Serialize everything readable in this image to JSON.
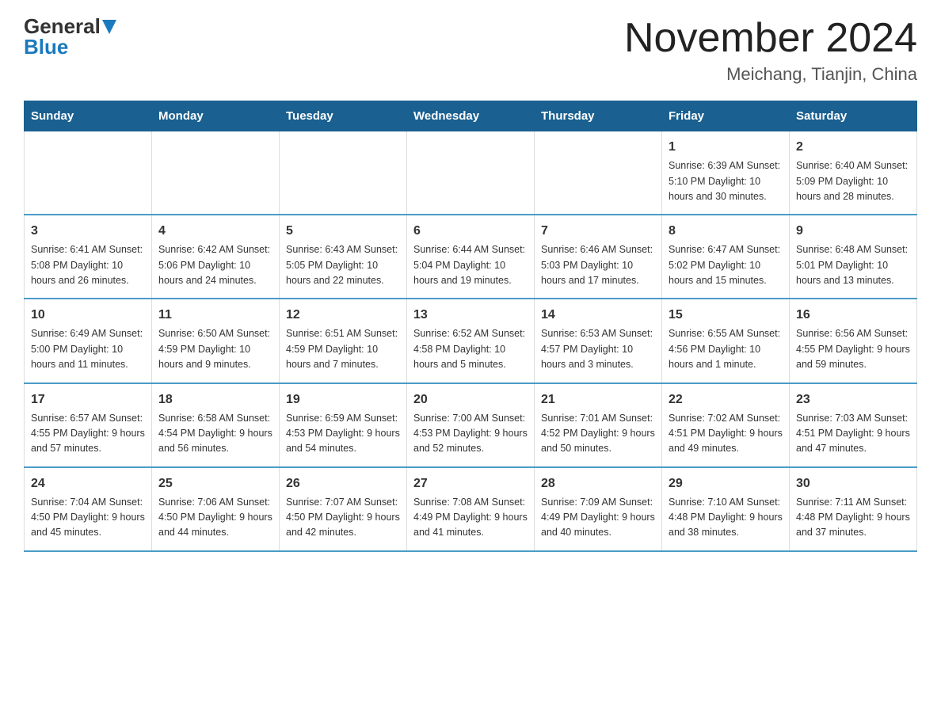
{
  "header": {
    "logo_general": "General",
    "logo_blue": "Blue",
    "month_title": "November 2024",
    "location": "Meichang, Tianjin, China"
  },
  "weekdays": [
    "Sunday",
    "Monday",
    "Tuesday",
    "Wednesday",
    "Thursday",
    "Friday",
    "Saturday"
  ],
  "weeks": [
    [
      {
        "day": "",
        "info": ""
      },
      {
        "day": "",
        "info": ""
      },
      {
        "day": "",
        "info": ""
      },
      {
        "day": "",
        "info": ""
      },
      {
        "day": "",
        "info": ""
      },
      {
        "day": "1",
        "info": "Sunrise: 6:39 AM\nSunset: 5:10 PM\nDaylight: 10 hours\nand 30 minutes."
      },
      {
        "day": "2",
        "info": "Sunrise: 6:40 AM\nSunset: 5:09 PM\nDaylight: 10 hours\nand 28 minutes."
      }
    ],
    [
      {
        "day": "3",
        "info": "Sunrise: 6:41 AM\nSunset: 5:08 PM\nDaylight: 10 hours\nand 26 minutes."
      },
      {
        "day": "4",
        "info": "Sunrise: 6:42 AM\nSunset: 5:06 PM\nDaylight: 10 hours\nand 24 minutes."
      },
      {
        "day": "5",
        "info": "Sunrise: 6:43 AM\nSunset: 5:05 PM\nDaylight: 10 hours\nand 22 minutes."
      },
      {
        "day": "6",
        "info": "Sunrise: 6:44 AM\nSunset: 5:04 PM\nDaylight: 10 hours\nand 19 minutes."
      },
      {
        "day": "7",
        "info": "Sunrise: 6:46 AM\nSunset: 5:03 PM\nDaylight: 10 hours\nand 17 minutes."
      },
      {
        "day": "8",
        "info": "Sunrise: 6:47 AM\nSunset: 5:02 PM\nDaylight: 10 hours\nand 15 minutes."
      },
      {
        "day": "9",
        "info": "Sunrise: 6:48 AM\nSunset: 5:01 PM\nDaylight: 10 hours\nand 13 minutes."
      }
    ],
    [
      {
        "day": "10",
        "info": "Sunrise: 6:49 AM\nSunset: 5:00 PM\nDaylight: 10 hours\nand 11 minutes."
      },
      {
        "day": "11",
        "info": "Sunrise: 6:50 AM\nSunset: 4:59 PM\nDaylight: 10 hours\nand 9 minutes."
      },
      {
        "day": "12",
        "info": "Sunrise: 6:51 AM\nSunset: 4:59 PM\nDaylight: 10 hours\nand 7 minutes."
      },
      {
        "day": "13",
        "info": "Sunrise: 6:52 AM\nSunset: 4:58 PM\nDaylight: 10 hours\nand 5 minutes."
      },
      {
        "day": "14",
        "info": "Sunrise: 6:53 AM\nSunset: 4:57 PM\nDaylight: 10 hours\nand 3 minutes."
      },
      {
        "day": "15",
        "info": "Sunrise: 6:55 AM\nSunset: 4:56 PM\nDaylight: 10 hours\nand 1 minute."
      },
      {
        "day": "16",
        "info": "Sunrise: 6:56 AM\nSunset: 4:55 PM\nDaylight: 9 hours\nand 59 minutes."
      }
    ],
    [
      {
        "day": "17",
        "info": "Sunrise: 6:57 AM\nSunset: 4:55 PM\nDaylight: 9 hours\nand 57 minutes."
      },
      {
        "day": "18",
        "info": "Sunrise: 6:58 AM\nSunset: 4:54 PM\nDaylight: 9 hours\nand 56 minutes."
      },
      {
        "day": "19",
        "info": "Sunrise: 6:59 AM\nSunset: 4:53 PM\nDaylight: 9 hours\nand 54 minutes."
      },
      {
        "day": "20",
        "info": "Sunrise: 7:00 AM\nSunset: 4:53 PM\nDaylight: 9 hours\nand 52 minutes."
      },
      {
        "day": "21",
        "info": "Sunrise: 7:01 AM\nSunset: 4:52 PM\nDaylight: 9 hours\nand 50 minutes."
      },
      {
        "day": "22",
        "info": "Sunrise: 7:02 AM\nSunset: 4:51 PM\nDaylight: 9 hours\nand 49 minutes."
      },
      {
        "day": "23",
        "info": "Sunrise: 7:03 AM\nSunset: 4:51 PM\nDaylight: 9 hours\nand 47 minutes."
      }
    ],
    [
      {
        "day": "24",
        "info": "Sunrise: 7:04 AM\nSunset: 4:50 PM\nDaylight: 9 hours\nand 45 minutes."
      },
      {
        "day": "25",
        "info": "Sunrise: 7:06 AM\nSunset: 4:50 PM\nDaylight: 9 hours\nand 44 minutes."
      },
      {
        "day": "26",
        "info": "Sunrise: 7:07 AM\nSunset: 4:50 PM\nDaylight: 9 hours\nand 42 minutes."
      },
      {
        "day": "27",
        "info": "Sunrise: 7:08 AM\nSunset: 4:49 PM\nDaylight: 9 hours\nand 41 minutes."
      },
      {
        "day": "28",
        "info": "Sunrise: 7:09 AM\nSunset: 4:49 PM\nDaylight: 9 hours\nand 40 minutes."
      },
      {
        "day": "29",
        "info": "Sunrise: 7:10 AM\nSunset: 4:48 PM\nDaylight: 9 hours\nand 38 minutes."
      },
      {
        "day": "30",
        "info": "Sunrise: 7:11 AM\nSunset: 4:48 PM\nDaylight: 9 hours\nand 37 minutes."
      }
    ]
  ]
}
